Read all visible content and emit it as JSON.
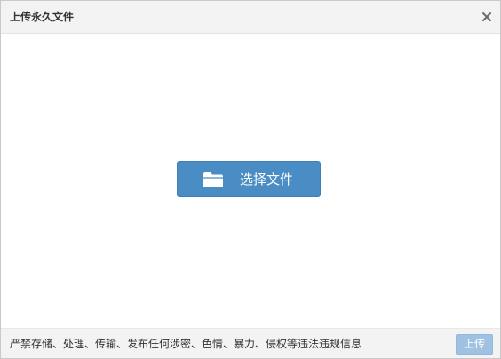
{
  "dialog": {
    "title": "上传永久文件",
    "close_icon": "close-icon"
  },
  "main": {
    "select_button_label": "选择文件",
    "select_button_icon": "folder-icon"
  },
  "footer": {
    "notice": "严禁存储、处理、传输、发布任何涉密、色情、暴力、侵权等违法违规信息",
    "upload_label": "上传",
    "upload_enabled": false
  },
  "colors": {
    "primary": "#4a8cc4",
    "upload_disabled": "#9fc2e3",
    "titlebar": "#f3f3f3"
  }
}
